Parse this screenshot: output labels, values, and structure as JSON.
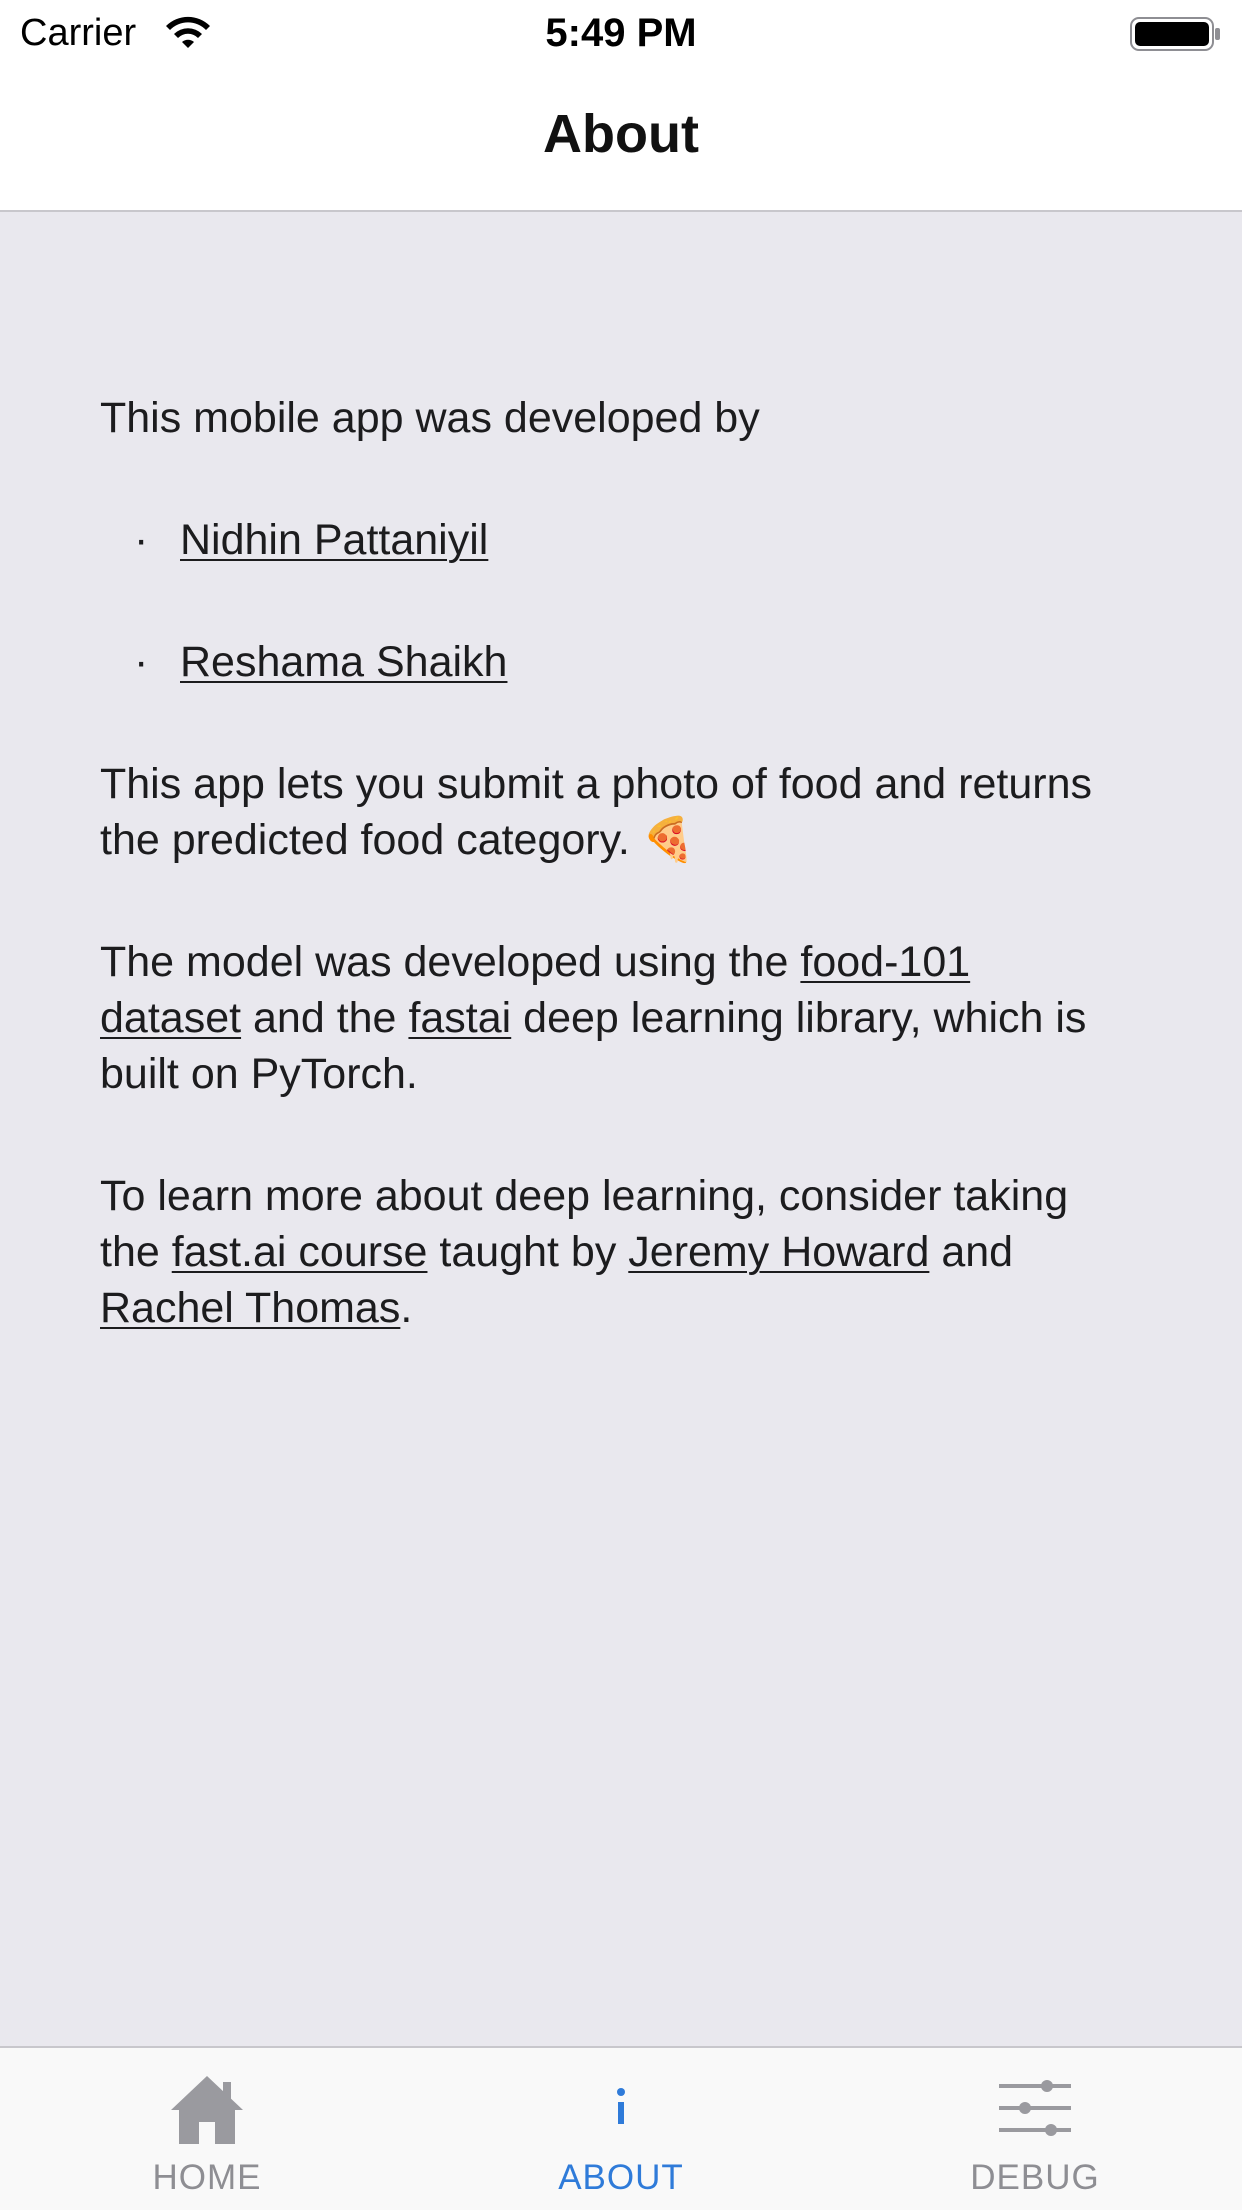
{
  "status_bar": {
    "carrier": "Carrier",
    "time": "5:49 PM"
  },
  "nav": {
    "title": "About"
  },
  "about": {
    "intro": "This mobile app was developed by",
    "developers": [
      "Nidhin Pattaniyil",
      "Reshama Shaikh"
    ],
    "app_desc": "This app lets you submit a photo of food and returns the predicted food category.",
    "app_desc_emoji": "🍕",
    "model_prefix": "The model was developed using the ",
    "model_link_dataset": "food-101 dataset",
    "model_middle": " and the ",
    "model_link_library": "fastai",
    "model_suffix": " deep learning library, which is built on PyTorch.",
    "learn_prefix": "To learn more about deep learning, consider taking the ",
    "learn_link_course": "fast.ai course",
    "learn_middle": " taught by ",
    "learn_link_person1": "Jeremy Howard",
    "learn_and": " and ",
    "learn_link_person2": "Rachel Thomas",
    "learn_suffix": "."
  },
  "tabs": [
    {
      "label": "HOME",
      "icon": "home-icon",
      "active": false
    },
    {
      "label": "ABOUT",
      "icon": "info-icon",
      "active": true
    },
    {
      "label": "DEBUG",
      "icon": "sliders-icon",
      "active": false
    }
  ],
  "colors": {
    "background": "#e9e8ee",
    "active_tab": "#2f7bd9",
    "inactive_tab": "#8e8e93"
  }
}
